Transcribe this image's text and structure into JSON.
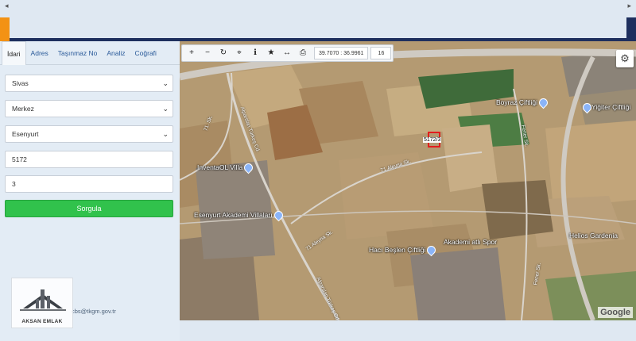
{
  "tabs": [
    "İdari",
    "Adres",
    "Taşınmaz No",
    "Analiz",
    "Coğrafi"
  ],
  "form": {
    "province": "Sivas",
    "district": "Merkez",
    "neighborhood": "Esenyurt",
    "block_no": "5172",
    "parcel_no": "3",
    "query_button": "Sorgula"
  },
  "footer": {
    "email": "cbs@tkgm.gov.tr"
  },
  "logo": {
    "text": "AKSAN EMLAK"
  },
  "toolbar": {
    "coordinates": "39.7070 : 36.9961",
    "zoom": "16"
  },
  "map": {
    "parcel_label": "5172/3",
    "pois": [
      "InventaOL Villa",
      "Esenyurt Akademi Villaları",
      "Boyraz Çiftliği",
      "Yiğiter Çiftliği",
      "Helios Gardenia",
      "Akademi atlı Spor",
      "Hacı Beşlen Çiftliği"
    ],
    "streets": [
      "Alparslan Türkeş Cd.",
      "71 Aleyna Sk.",
      "71 Aleyna Sk.",
      "Fener Sk.",
      "Fener Sk.",
      "71. Sk.",
      "Alparslan Türkeş Cd."
    ],
    "attribution": "Google"
  },
  "colors": {
    "accent": "#31c24c",
    "orange": "#f39214",
    "navy": "#1e2f5e"
  }
}
